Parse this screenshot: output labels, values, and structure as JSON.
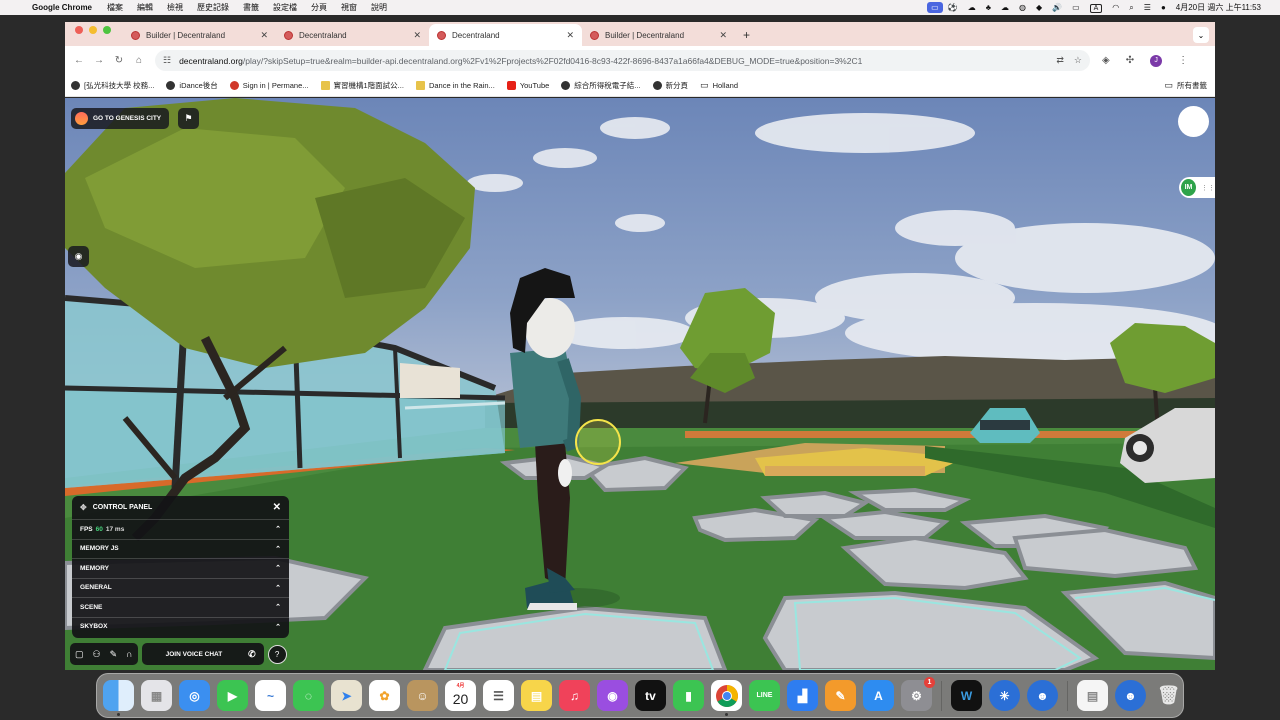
{
  "menubar": {
    "apple_icon": "apple-icon",
    "app_name": "Google Chrome",
    "menus": [
      "檔案",
      "編輯",
      "檢視",
      "歷史記錄",
      "書籤",
      "設定檔",
      "分頁",
      "視窗",
      "說明"
    ],
    "datetime": "4月20日 週六 上午11:53"
  },
  "chrome": {
    "tabs": [
      {
        "title": "Builder | Decentraland",
        "active": false
      },
      {
        "title": "Decentraland",
        "active": false
      },
      {
        "title": "Decentraland",
        "active": true
      },
      {
        "title": "Builder | Decentraland",
        "active": false
      }
    ],
    "url_host": "decentraland.org",
    "url_path": "/play/?skipSetup=true&realm=builder-api.decentraland.org%2Fv1%2Fprojects%2F02fd0416-8c93-422f-8696-8437a1a66fa4&DEBUG_MODE=true&position=3%2C1",
    "profile_initial": "J",
    "bookmarks": [
      {
        "label": "[弘光科技大學 校務...",
        "color": "#333"
      },
      {
        "label": "iDance後台",
        "color": "#333"
      },
      {
        "label": "Sign in | Permane...",
        "color": "#d0392b"
      },
      {
        "label": "實習機構1階面試公...",
        "color": "#e7c34a"
      },
      {
        "label": "Dance in the Rain...",
        "color": "#e7c34a"
      },
      {
        "label": "YouTube",
        "color": "#e62117"
      },
      {
        "label": "綜合所得稅電子結...",
        "color": "#333"
      },
      {
        "label": "新分頁",
        "color": "#333"
      },
      {
        "label": "Holland",
        "color": "folder"
      }
    ],
    "all_bookmarks": "所有書籤"
  },
  "game": {
    "genesis_button": "GO TO GENESIS CITY",
    "control_panel": {
      "title": "CONTROL PANEL",
      "fps_label": "FPS",
      "fps_value": "60",
      "fps_ms": "17 ms",
      "sections": [
        "MEMORY JS",
        "MEMORY",
        "GENERAL",
        "SCENE",
        "SKYBOX"
      ]
    },
    "voice_chat_label": "JOIN VOICE CHAT",
    "help_label": "?",
    "im_badge": "IM"
  },
  "dock": {
    "calendar_month": "4月",
    "calendar_day": "20",
    "settings_badge": "1",
    "apps": [
      "Finder",
      "Launchpad",
      "Safari",
      "FaceTime",
      "Freeform",
      "Messages",
      "Maps",
      "Photos",
      "Contacts",
      "Calendar",
      "Reminders",
      "Notes",
      "Music",
      "Podcasts",
      "TV",
      "Numbers",
      "Chrome",
      "LINE",
      "Keynote",
      "Pages",
      "App Store",
      "System Settings",
      "Webex",
      "Decentraland",
      "Decentraland Launcher",
      "Document",
      "Decentraland Explorer",
      "Trash"
    ]
  }
}
